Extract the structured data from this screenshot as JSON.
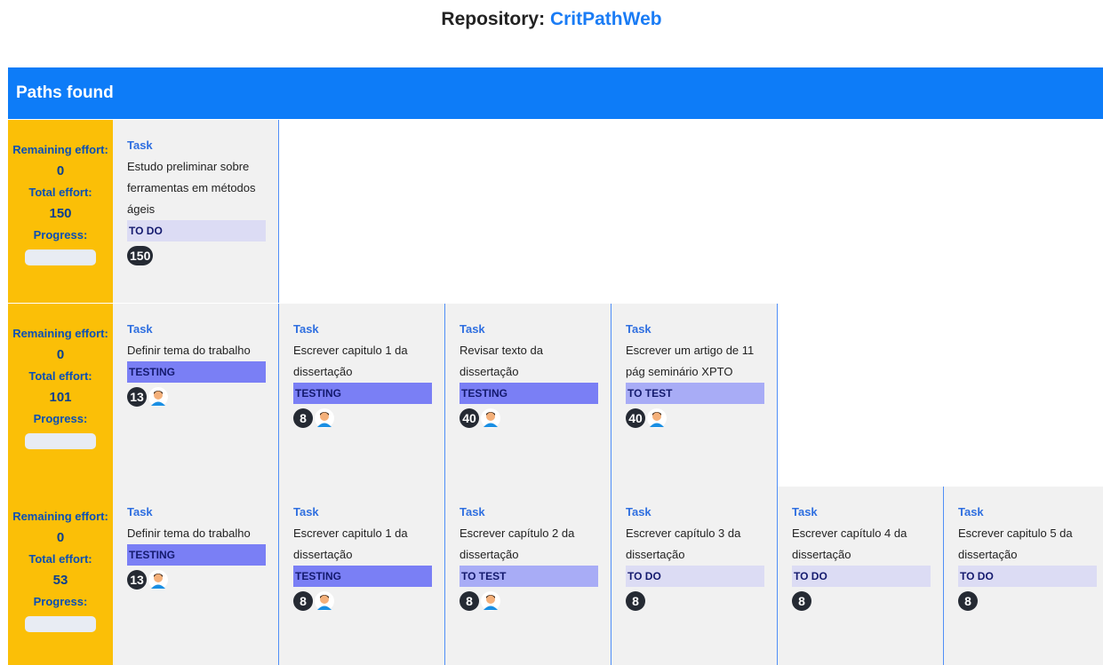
{
  "header": {
    "repo_label": "Repository:",
    "repo_name": "CritPathWeb"
  },
  "paths_header": "Paths found",
  "summary_labels": {
    "remaining": "Remaining effort:",
    "total": "Total effort:",
    "progress": "Progress:"
  },
  "paths": [
    {
      "remaining": "0",
      "total": "150",
      "tasks": [
        {
          "kind": "Task",
          "title": "Estudo preliminar sobre ferramentas em métodos ágeis",
          "status": "TO DO",
          "status_type": "todo",
          "effort": "150",
          "avatar": false
        }
      ]
    },
    {
      "remaining": "0",
      "total": "101",
      "tasks": [
        {
          "kind": "Task",
          "title": "Definir tema do trabalho",
          "status": "TESTING",
          "status_type": "testing",
          "effort": "13",
          "avatar": true
        },
        {
          "kind": "Task",
          "title": "Escrever capitulo 1 da dissertação",
          "status": "TESTING",
          "status_type": "testing",
          "effort": "8",
          "avatar": true
        },
        {
          "kind": "Task",
          "title": "Revisar texto da dissertação",
          "status": "TESTING",
          "status_type": "testing",
          "effort": "40",
          "avatar": true
        },
        {
          "kind": "Task",
          "title": "Escrever um artigo de 11 pág seminário XPTO",
          "status": "TO TEST",
          "status_type": "totest",
          "effort": "40",
          "avatar": true
        }
      ]
    },
    {
      "remaining": "0",
      "total": "53",
      "tasks": [
        {
          "kind": "Task",
          "title": "Definir tema do trabalho",
          "status": "TESTING",
          "status_type": "testing",
          "effort": "13",
          "avatar": true
        },
        {
          "kind": "Task",
          "title": "Escrever capitulo 1 da dissertação",
          "status": "TESTING",
          "status_type": "testing",
          "effort": "8",
          "avatar": true
        },
        {
          "kind": "Task",
          "title": "Escrever capítulo 2 da dissertação",
          "status": "TO TEST",
          "status_type": "totest",
          "effort": "8",
          "avatar": true
        },
        {
          "kind": "Task",
          "title": "Escrever capítulo 3 da dissertação",
          "status": "TO DO",
          "status_type": "todo",
          "effort": "8",
          "avatar": false
        },
        {
          "kind": "Task",
          "title": "Escrever capítulo 4 da dissertação",
          "status": "TO DO",
          "status_type": "todo",
          "effort": "8",
          "avatar": false
        },
        {
          "kind": "Task",
          "title": "Escrever capitulo 5 da dissertação",
          "status": "TO DO",
          "status_type": "todo",
          "effort": "8",
          "avatar": false
        }
      ]
    }
  ],
  "colors": {
    "header_blue": "#0d7cf8",
    "summary_yellow": "#fbbf07",
    "testing": "#7a7ff5",
    "to_test": "#a8acf6",
    "to_do": "#dcdcf4"
  },
  "icons": {
    "avatar": "person-avatar-icon"
  }
}
